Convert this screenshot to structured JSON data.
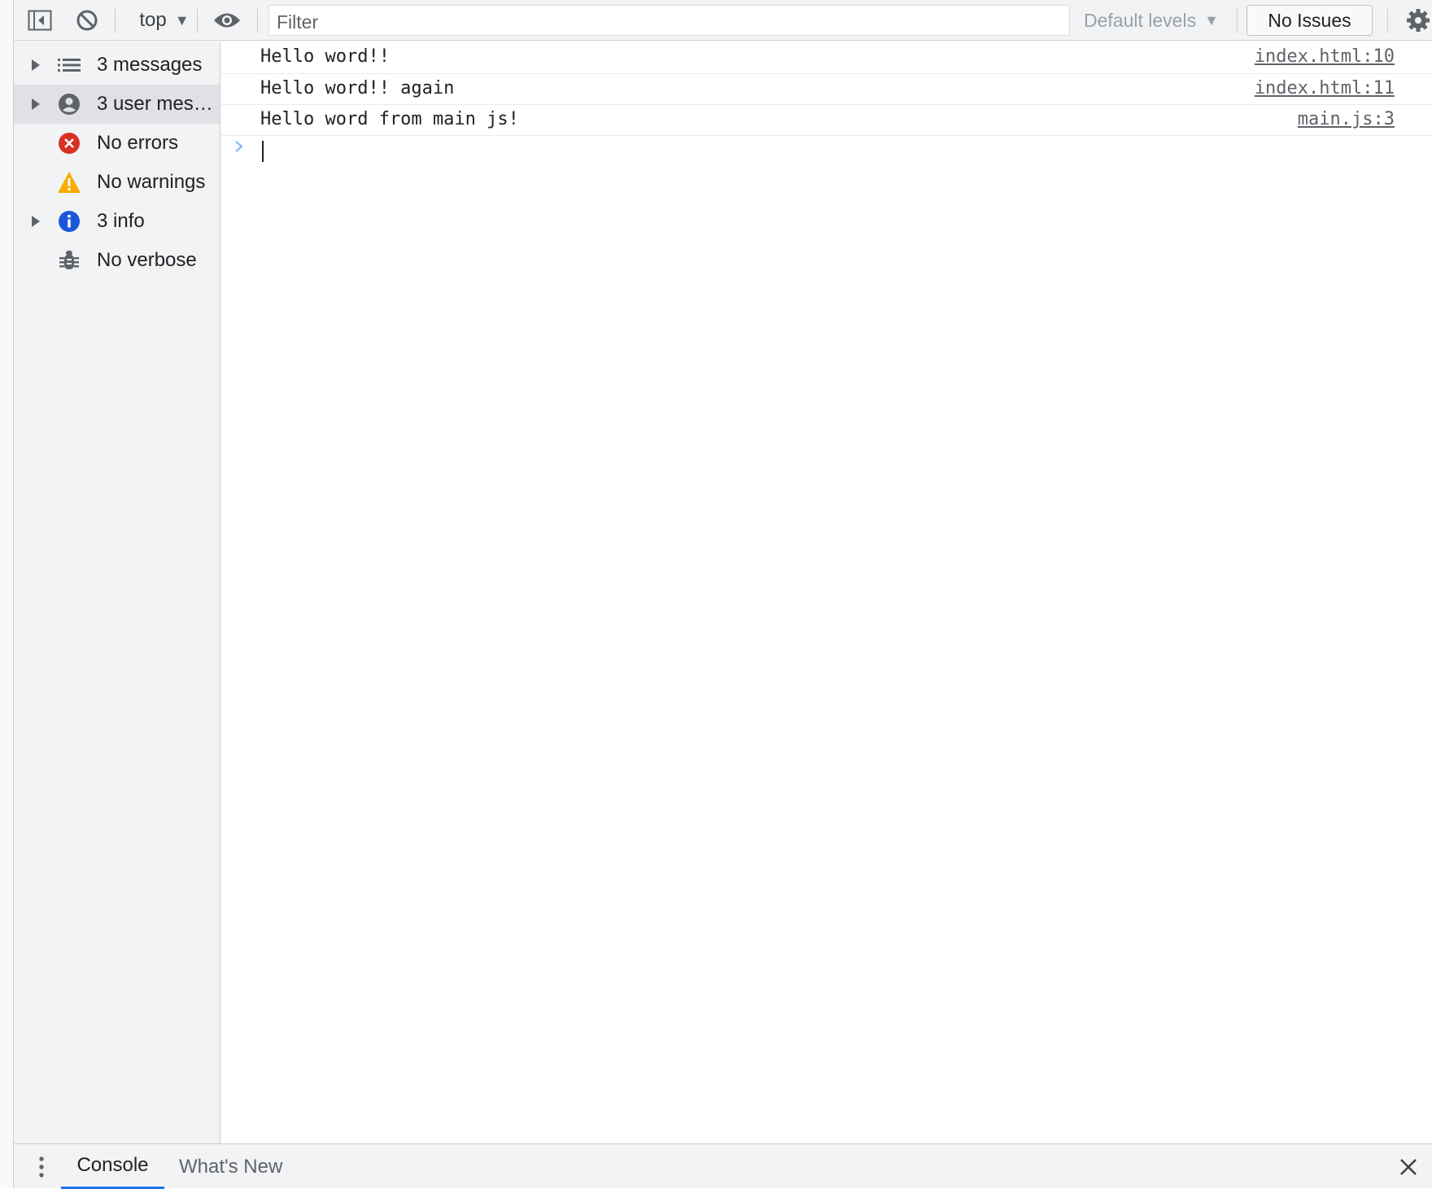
{
  "toolbar": {
    "context": "top",
    "filter_placeholder": "Filter",
    "levels_label": "Default levels",
    "issues_label": "No Issues"
  },
  "sidebar": {
    "items": [
      {
        "label": "3 messages",
        "icon": "list-icon"
      },
      {
        "label": "3 user mes…",
        "icon": "user-icon"
      },
      {
        "label": "No errors",
        "icon": "error-icon"
      },
      {
        "label": "No warnings",
        "icon": "warning-icon"
      },
      {
        "label": "3 info",
        "icon": "info-icon"
      },
      {
        "label": "No verbose",
        "icon": "bug-icon"
      }
    ]
  },
  "console": {
    "messages": [
      {
        "text": "Hello word!! again",
        "source": "index.html:11"
      },
      {
        "text": "Hello word!!",
        "source": "index.html:10"
      },
      {
        "text": "Hello word from main js!",
        "source": "main.js:3"
      }
    ]
  },
  "drawer": {
    "tabs": [
      "Console",
      "What's New"
    ]
  },
  "colors": {
    "accent": "#1a73e8",
    "error": "#d93025",
    "warning": "#f9ab00",
    "info": "#1a56db"
  }
}
